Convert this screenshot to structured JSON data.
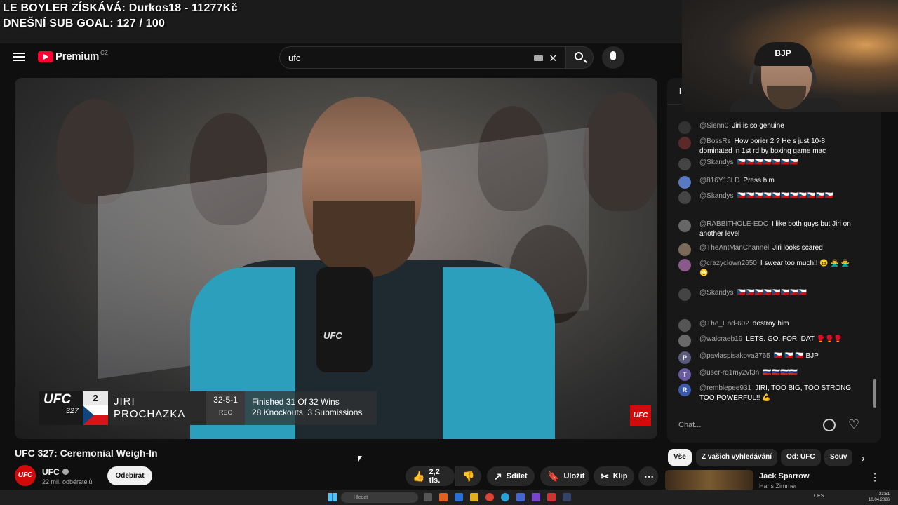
{
  "overlay": {
    "line1": "LE BOYLER ZÍSKÁVÁ: Durkos18 - 11277Kč",
    "line2": "DNEŠNÍ SUB GOAL: 127 / 100"
  },
  "header": {
    "logo_text": "Premium",
    "logo_region": "CZ",
    "search_value": "ufc"
  },
  "video": {
    "lower_third": {
      "logo": "UFC",
      "event_number": "327",
      "rank": "2",
      "first_name": "JIRI",
      "last_name": "PROCHAZKA",
      "record": "32-5-1",
      "record_label": "REC",
      "stat_line1": "Finished 31 Of 32 Wins",
      "stat_line2": "28 Knockouts, 3 Submissions"
    },
    "mic_label": "UFC",
    "bug": "UFC",
    "title": "UFC 327: Ceremonial Weigh-In"
  },
  "channel": {
    "avatar_text": "UFC",
    "name": "UFC",
    "subscribers": "22 mil. odběratelů",
    "subscribe_label": "Odebírat"
  },
  "actions": {
    "likes": "2,2 tis.",
    "share": "Sdílet",
    "save": "Uložit",
    "clip": "Klip"
  },
  "webcam": {
    "cap_text": "BJP"
  },
  "chat": {
    "header": "I",
    "messages": [
      {
        "user": "@Sienn0",
        "text": "Jiri is so genuine",
        "avatar": "",
        "color": "#333333"
      },
      {
        "user": "@BossRs",
        "text": "How porier 2 ? He s just 10-8 dominated in 1st rd by boxing game mac",
        "avatar": "",
        "color": "#5a2a2a"
      },
      {
        "user": "@Skandys",
        "text": "🇨🇿🇨🇿🇨🇿🇨🇿🇨🇿🇨🇿🇨🇿",
        "avatar": "",
        "color": "#444444"
      },
      {
        "user": "@816Y13LD",
        "text": "Press him",
        "avatar": "",
        "color": "#5a7ac0"
      },
      {
        "user": "@Skandys",
        "text": "🇨🇿🇨🇿🇨🇿🇨🇿🇨🇿🇨🇿🇨🇿🇨🇿🇨🇿🇨🇿🇨🇿",
        "avatar": "",
        "color": "#444444"
      },
      {
        "user": "@RABBITHOLE-EDC",
        "text": "I like both guys but Jiri on another level",
        "avatar": "",
        "color": "#666666"
      },
      {
        "user": "@TheAntManChannel",
        "text": "Jiri looks scared",
        "avatar": "",
        "color": "#7a6a5a"
      },
      {
        "user": "@crazyclown2650",
        "text": "I swear too much!! 😖 🙅‍♂️ 🙅‍♂️ 🙄",
        "avatar": "",
        "color": "#8a5a8a"
      },
      {
        "user": "@Skandys",
        "text": "🇨🇿🇨🇿🇨🇿🇨🇿🇨🇿🇨🇿🇨🇿🇨🇿",
        "avatar": "",
        "color": "#444444"
      },
      {
        "user": "@The_End-602",
        "text": "destroy him",
        "avatar": "",
        "color": "#555555"
      },
      {
        "user": "@walcraeb19",
        "text": "LETS. GO. FOR. DAT 🥊🥊🥊",
        "avatar": "",
        "color": "#6a6a6a"
      },
      {
        "user": "@pavlaspisakova3765",
        "text": "🇨🇿 🇨🇿 🇨🇿 BJP",
        "avatar": "P",
        "color": "#5a5a7a"
      },
      {
        "user": "@user-rq1my2vf3n",
        "text": "🇷🇺🇷🇺🇷🇺🇷🇺",
        "avatar": "T",
        "color": "#6a5aa0"
      },
      {
        "user": "@remblepee931",
        "text": "JIRI, TOO BIG, TOO STRONG, TOO POWERFUL!! 💪",
        "avatar": "R",
        "color": "#3a5ab0"
      }
    ],
    "input_placeholder": "Chat..."
  },
  "chips": [
    "Vše",
    "Z vašich vyhledávání",
    "Od: UFC",
    "Souv"
  ],
  "recommendation": {
    "title": "Jack Sparrow",
    "artist": "Hans Zimmer"
  },
  "taskbar": {
    "search_placeholder": "Hledat",
    "tray": "CES",
    "time": "23:51",
    "date": "10.04.2026"
  }
}
